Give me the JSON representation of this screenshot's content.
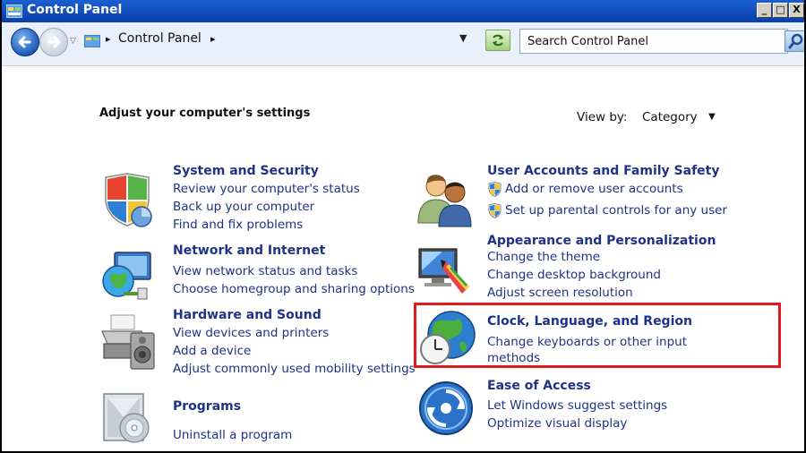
{
  "window": {
    "title": "Control Panel",
    "minimize": "_",
    "maximize": "□",
    "close": "X"
  },
  "address_bar": {
    "crumbs": [
      "▸",
      "Control Panel",
      "▸"
    ],
    "dropdown_arrow": "▼",
    "history_arrow": "▽",
    "search_placeholder": "Search Control Panel"
  },
  "main": {
    "heading": "Adjust your computer's settings",
    "view_by": {
      "label": "View by:",
      "value": "Category",
      "arrow": "▼"
    },
    "left_categories": [
      {
        "title": "System and Security",
        "icon": "shield-icon",
        "links": [
          "Review your computer's status",
          "Back up your computer",
          "Find and fix problems"
        ]
      },
      {
        "title": "Network and Internet",
        "icon": "globe-network-icon",
        "links": [
          "View network status and tasks",
          "Choose homegroup and sharing options"
        ]
      },
      {
        "title": "Hardware and Sound",
        "icon": "printer-icon",
        "links": [
          "View devices and printers",
          "Add a device",
          "Adjust commonly used mobility settings"
        ]
      },
      {
        "title": "Programs",
        "icon": "programs-icon",
        "links": [
          "Uninstall a program"
        ]
      }
    ],
    "right_categories": [
      {
        "title": "User Accounts and Family Safety",
        "icon": "users-icon",
        "links": [
          "Add or remove user accounts",
          "Set up parental controls for any user"
        ]
      },
      {
        "title": "Appearance and Personalization",
        "icon": "monitor-paint-icon",
        "links": [
          "Change the theme",
          "Change desktop background",
          "Adjust screen resolution"
        ]
      },
      {
        "title": "Clock, Language, and Region",
        "icon": "clock-globe-icon",
        "links": [
          "Change keyboards or other input",
          "methods"
        ]
      },
      {
        "title": "Ease of Access",
        "icon": "ease-of-access-icon",
        "links": [
          "Let Windows suggest settings",
          "Optimize visual display"
        ]
      }
    ]
  },
  "colors": {
    "link": "#1e3287",
    "highlight_border": "#e01b1b",
    "titlebar": "#0a3ea8"
  }
}
